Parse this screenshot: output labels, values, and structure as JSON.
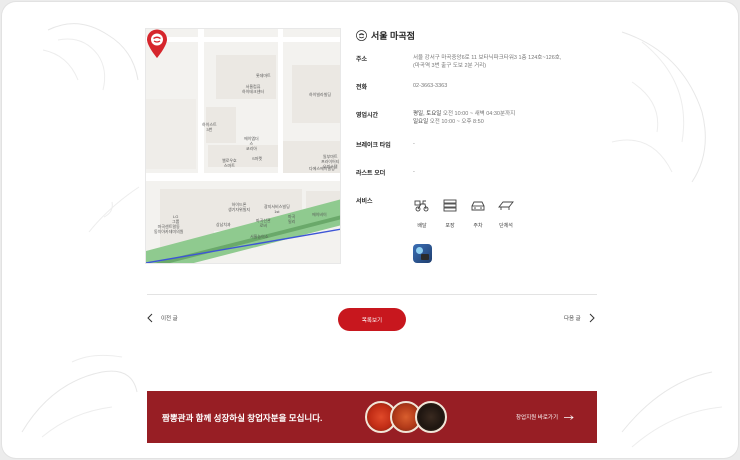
{
  "store": {
    "name": "서울 마곡점",
    "address_label": "주소",
    "address_line1": "서울 강서구 마곡중앙6로 11 보타닉파크타워3 1층 124호~126호,",
    "address_line2": "(마곡역 3번 출구 도보 2분 거리)",
    "phone_label": "전화",
    "phone": "02-3663-3363",
    "hours_label": "영업시간",
    "hours_line1_day": "평일, 토요일",
    "hours_line1_time": " 오전 10:00 ~ 새벽 04:30분까지",
    "hours_line2_day": "일요일",
    "hours_line2_time": " 오전 10:00 ~ 오후 8:50",
    "break_label": "브레이크 타임",
    "break_value": "-",
    "lastorder_label": "라스트 오더",
    "lastorder_value": "-",
    "services_label": "서비스",
    "services": [
      {
        "label": "배달",
        "icon": "delivery-icon"
      },
      {
        "label": "포장",
        "icon": "takeout-icon"
      },
      {
        "label": "주차",
        "icon": "parking-icon"
      },
      {
        "label": "단체석",
        "icon": "group-seat-icon"
      }
    ]
  },
  "map": {
    "labels": [
      "롯데마트",
      "서울컴퓨\n하이테크센터",
      "하이빌라빌딩",
      "하이스트\n3번",
      "옐로우호\n스마트",
      "S마켓",
      "에이엠더\n스\n코리아",
      "일부마트\n프라이어티\n오피스텔",
      "다에스에이빌딩",
      "LG\n그룹",
      "하이드론\n생기자위빌지",
      "광지서비스빌딩\n1st",
      "마곡\n밀리",
      "에이비이",
      "마곡센트럴동\n동치아카데미의원",
      "상남치과",
      "마곡신관\n로비",
      "서울농이소"
    ]
  },
  "pagination": {
    "prev_label": "이전 글",
    "list_label": "목록보기",
    "next_label": "다음 글"
  },
  "banner": {
    "text": "짬뽕관과 함께 성장하실 창업자분을 모십니다.",
    "cta": "창업지원 바로가기"
  },
  "colors": {
    "brand_red": "#c8171e",
    "banner_bg": "#971e24",
    "park_green": "#7fbf7f"
  }
}
